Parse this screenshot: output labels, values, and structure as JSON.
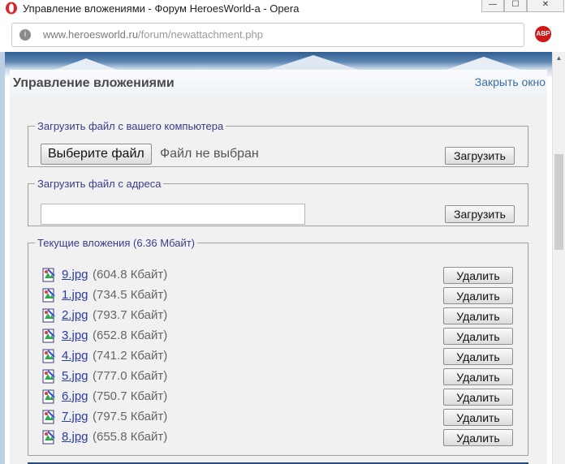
{
  "window": {
    "title": "Управление вложениями - Форум HeroesWorld-а - Opera",
    "minimize": "—",
    "maximize": "☐",
    "close": "✕"
  },
  "address": {
    "domain": "www.heroesworld.ru",
    "path": "/forum/newattachment.php",
    "site_info": "i",
    "abp": "ABP"
  },
  "header": {
    "title": "Управление вложениями",
    "close_link": "Закрыть окно"
  },
  "upload_computer": {
    "legend": "Загрузить файл с вашего компьютера",
    "choose_label": "Выберите файл",
    "no_file": "Файл не выбран",
    "upload_label": "Загрузить"
  },
  "upload_url": {
    "legend": "Загрузить файл с адреса",
    "value": "",
    "upload_label": "Загрузить"
  },
  "attachments": {
    "legend": "Текущие вложения (6.36 Мбайт)",
    "delete_label": "Удалить",
    "items": [
      {
        "name": "9.jpg",
        "size": "(604.8 Кбайт)"
      },
      {
        "name": "1.jpg",
        "size": "(734.5 Кбайт)"
      },
      {
        "name": "2.jpg",
        "size": "(793.7 Кбайт)"
      },
      {
        "name": "3.jpg",
        "size": "(652.8 Кбайт)"
      },
      {
        "name": "4.jpg",
        "size": "(741.2 Кбайт)"
      },
      {
        "name": "5.jpg",
        "size": "(777.0 Кбайт)"
      },
      {
        "name": "6.jpg",
        "size": "(750.7 Кбайт)"
      },
      {
        "name": "7.jpg",
        "size": "(797.5 Кбайт)"
      },
      {
        "name": "8.jpg",
        "size": "(655.8 Кбайт)"
      }
    ]
  },
  "colors": {
    "link": "#2a3aa6",
    "legend": "#3b3b8c",
    "abp_red": "#d01717",
    "opera_red": "#e0242b"
  }
}
